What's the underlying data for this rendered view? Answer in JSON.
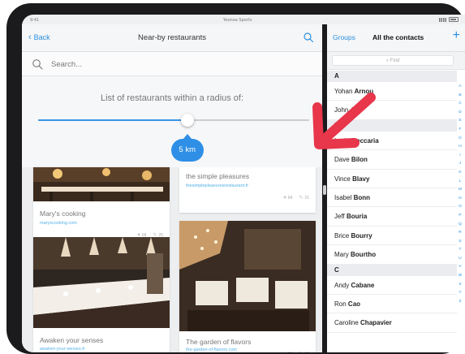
{
  "status_bar": {
    "time": "9:41",
    "center": "Yoonoa Sports"
  },
  "left_panel": {
    "back_label": "Back",
    "title": "Near-by restaurants",
    "search_placeholder": "Search...",
    "radius_label": "List of restaurants within a radius of:",
    "slider": {
      "fraction": 0.55,
      "value_label": "5 km"
    },
    "restaurants": [
      {
        "name": "Mary's cooking",
        "link": "maryscooking.com",
        "likes": "68",
        "comments": "25"
      },
      {
        "name": "the simple pleasures",
        "link": "thesimplepleasuresrestaurant.fr",
        "likes": "84",
        "comments": "21"
      },
      {
        "name": "Awaken your senses",
        "link": "awaken-your-senses.fr",
        "likes": "",
        "comments": ""
      },
      {
        "name": "The garden of flavors",
        "link": "the-garden-of-flavors.com",
        "likes": "71",
        "comments": "18"
      }
    ]
  },
  "contacts_panel": {
    "groups_label": "Groups",
    "title": "All the contacts",
    "add_label": "+",
    "find_placeholder": "Find",
    "sections": [
      {
        "letter": "A",
        "contacts": [
          {
            "first": "Yohan",
            "last": "Arnou"
          },
          {
            "first": "John",
            "last": "Au"
          }
        ]
      },
      {
        "letter": "B",
        "contacts": [
          {
            "first": "Lucie",
            "last": "Beccaria"
          },
          {
            "first": "Dave",
            "last": "Bilon"
          },
          {
            "first": "Vince",
            "last": "Blavy"
          },
          {
            "first": "Isabel",
            "last": "Bonn"
          },
          {
            "first": "Jeff",
            "last": "Bouria"
          },
          {
            "first": "Brice",
            "last": "Bourry"
          },
          {
            "first": "Mary",
            "last": "Bourtho"
          }
        ]
      },
      {
        "letter": "C",
        "contacts": [
          {
            "first": "Andy",
            "last": "Cabane"
          },
          {
            "first": "Ron",
            "last": "Cao"
          },
          {
            "first": "Caroline",
            "last": "Chapavier"
          }
        ]
      }
    ],
    "index_letters": [
      "A",
      "B",
      "C",
      "D",
      "E",
      "F",
      "G",
      "H",
      "I",
      "J",
      "K",
      "L",
      "M",
      "N",
      "O",
      "P",
      "Q",
      "R",
      "S",
      "T",
      "U",
      "V",
      "W",
      "X",
      "Y",
      "Z"
    ]
  },
  "colors": {
    "accent": "#2f8fe6",
    "link": "#53b0e8",
    "arrow": "#e8364a"
  },
  "icons": [
    "back-chevron-icon",
    "search-icon",
    "add-icon",
    "heart-icon",
    "comment-icon",
    "pointer-arrow-icon"
  ]
}
